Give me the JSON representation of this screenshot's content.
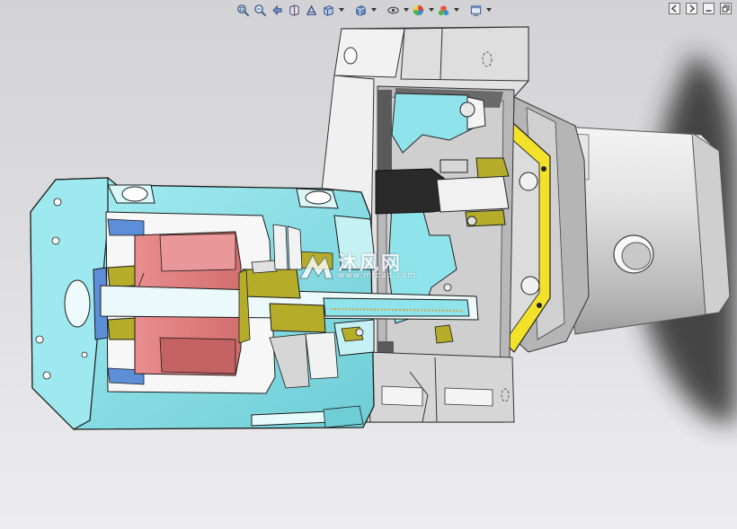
{
  "app": {
    "view": "section-view",
    "model": "gear pump with motor assembly"
  },
  "toolbar": {
    "buttons": [
      {
        "id": "zoom-to-fit",
        "icon": "zoom-fit-icon"
      },
      {
        "id": "zoom-to-area",
        "icon": "zoom-area-icon"
      },
      {
        "id": "previous-view",
        "icon": "previous-view-icon"
      },
      {
        "id": "section-view",
        "icon": "section-view-icon"
      },
      {
        "id": "dynamic-annotation",
        "icon": "annotation-icon"
      },
      {
        "id": "view-orientation",
        "icon": "view-orientation-icon"
      },
      {
        "id": "display-style",
        "icon": "display-style-icon"
      },
      {
        "id": "hide-show-items",
        "icon": "hide-show-icon"
      },
      {
        "id": "edit-appearance",
        "icon": "appearance-icon"
      },
      {
        "id": "apply-scene",
        "icon": "scene-icon"
      },
      {
        "id": "view-settings",
        "icon": "view-settings-icon"
      }
    ]
  },
  "watermark": {
    "brand": "沐风网",
    "url": "www.mfcad.com"
  },
  "colors": {
    "housing": "#8fe3ea",
    "stator": "#e07f80",
    "shaft_parts": "#b5ad2a",
    "gasket": "#f3e22a",
    "body_grey": "#c9c9c9",
    "body_light": "#e3e3e3",
    "dark_parts": "#2a2a2a",
    "shadow": "#3a3a3a"
  }
}
